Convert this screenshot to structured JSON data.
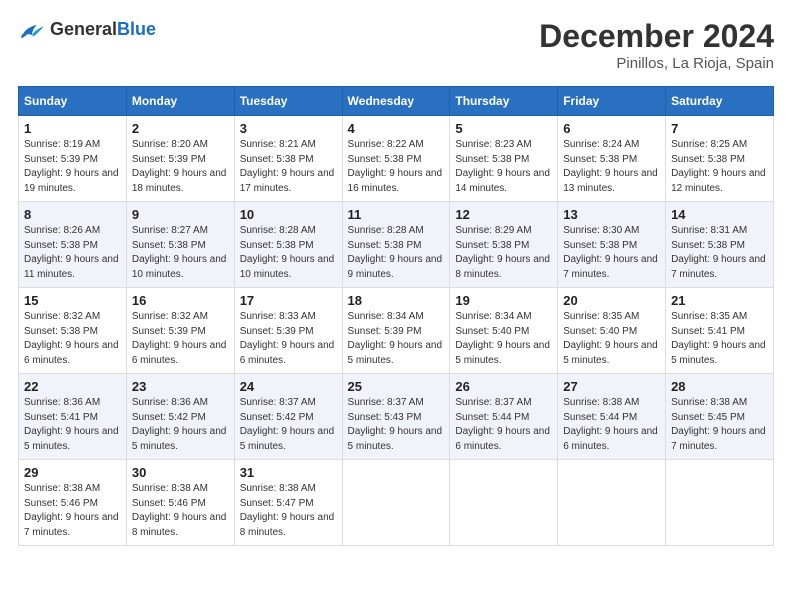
{
  "logo": {
    "general": "General",
    "blue": "Blue"
  },
  "header": {
    "month": "December 2024",
    "location": "Pinillos, La Rioja, Spain"
  },
  "weekdays": [
    "Sunday",
    "Monday",
    "Tuesday",
    "Wednesday",
    "Thursday",
    "Friday",
    "Saturday"
  ],
  "weeks": [
    [
      {
        "day": "1",
        "sunrise": "8:19 AM",
        "sunset": "5:39 PM",
        "daylight": "9 hours and 19 minutes."
      },
      {
        "day": "2",
        "sunrise": "8:20 AM",
        "sunset": "5:39 PM",
        "daylight": "9 hours and 18 minutes."
      },
      {
        "day": "3",
        "sunrise": "8:21 AM",
        "sunset": "5:38 PM",
        "daylight": "9 hours and 17 minutes."
      },
      {
        "day": "4",
        "sunrise": "8:22 AM",
        "sunset": "5:38 PM",
        "daylight": "9 hours and 16 minutes."
      },
      {
        "day": "5",
        "sunrise": "8:23 AM",
        "sunset": "5:38 PM",
        "daylight": "9 hours and 14 minutes."
      },
      {
        "day": "6",
        "sunrise": "8:24 AM",
        "sunset": "5:38 PM",
        "daylight": "9 hours and 13 minutes."
      },
      {
        "day": "7",
        "sunrise": "8:25 AM",
        "sunset": "5:38 PM",
        "daylight": "9 hours and 12 minutes."
      }
    ],
    [
      {
        "day": "8",
        "sunrise": "8:26 AM",
        "sunset": "5:38 PM",
        "daylight": "9 hours and 11 minutes."
      },
      {
        "day": "9",
        "sunrise": "8:27 AM",
        "sunset": "5:38 PM",
        "daylight": "9 hours and 10 minutes."
      },
      {
        "day": "10",
        "sunrise": "8:28 AM",
        "sunset": "5:38 PM",
        "daylight": "9 hours and 10 minutes."
      },
      {
        "day": "11",
        "sunrise": "8:28 AM",
        "sunset": "5:38 PM",
        "daylight": "9 hours and 9 minutes."
      },
      {
        "day": "12",
        "sunrise": "8:29 AM",
        "sunset": "5:38 PM",
        "daylight": "9 hours and 8 minutes."
      },
      {
        "day": "13",
        "sunrise": "8:30 AM",
        "sunset": "5:38 PM",
        "daylight": "9 hours and 7 minutes."
      },
      {
        "day": "14",
        "sunrise": "8:31 AM",
        "sunset": "5:38 PM",
        "daylight": "9 hours and 7 minutes."
      }
    ],
    [
      {
        "day": "15",
        "sunrise": "8:32 AM",
        "sunset": "5:38 PM",
        "daylight": "9 hours and 6 minutes."
      },
      {
        "day": "16",
        "sunrise": "8:32 AM",
        "sunset": "5:39 PM",
        "daylight": "9 hours and 6 minutes."
      },
      {
        "day": "17",
        "sunrise": "8:33 AM",
        "sunset": "5:39 PM",
        "daylight": "9 hours and 6 minutes."
      },
      {
        "day": "18",
        "sunrise": "8:34 AM",
        "sunset": "5:39 PM",
        "daylight": "9 hours and 5 minutes."
      },
      {
        "day": "19",
        "sunrise": "8:34 AM",
        "sunset": "5:40 PM",
        "daylight": "9 hours and 5 minutes."
      },
      {
        "day": "20",
        "sunrise": "8:35 AM",
        "sunset": "5:40 PM",
        "daylight": "9 hours and 5 minutes."
      },
      {
        "day": "21",
        "sunrise": "8:35 AM",
        "sunset": "5:41 PM",
        "daylight": "9 hours and 5 minutes."
      }
    ],
    [
      {
        "day": "22",
        "sunrise": "8:36 AM",
        "sunset": "5:41 PM",
        "daylight": "9 hours and 5 minutes."
      },
      {
        "day": "23",
        "sunrise": "8:36 AM",
        "sunset": "5:42 PM",
        "daylight": "9 hours and 5 minutes."
      },
      {
        "day": "24",
        "sunrise": "8:37 AM",
        "sunset": "5:42 PM",
        "daylight": "9 hours and 5 minutes."
      },
      {
        "day": "25",
        "sunrise": "8:37 AM",
        "sunset": "5:43 PM",
        "daylight": "9 hours and 5 minutes."
      },
      {
        "day": "26",
        "sunrise": "8:37 AM",
        "sunset": "5:44 PM",
        "daylight": "9 hours and 6 minutes."
      },
      {
        "day": "27",
        "sunrise": "8:38 AM",
        "sunset": "5:44 PM",
        "daylight": "9 hours and 6 minutes."
      },
      {
        "day": "28",
        "sunrise": "8:38 AM",
        "sunset": "5:45 PM",
        "daylight": "9 hours and 7 minutes."
      }
    ],
    [
      {
        "day": "29",
        "sunrise": "8:38 AM",
        "sunset": "5:46 PM",
        "daylight": "9 hours and 7 minutes."
      },
      {
        "day": "30",
        "sunrise": "8:38 AM",
        "sunset": "5:46 PM",
        "daylight": "9 hours and 8 minutes."
      },
      {
        "day": "31",
        "sunrise": "8:38 AM",
        "sunset": "5:47 PM",
        "daylight": "9 hours and 8 minutes."
      },
      null,
      null,
      null,
      null
    ]
  ]
}
